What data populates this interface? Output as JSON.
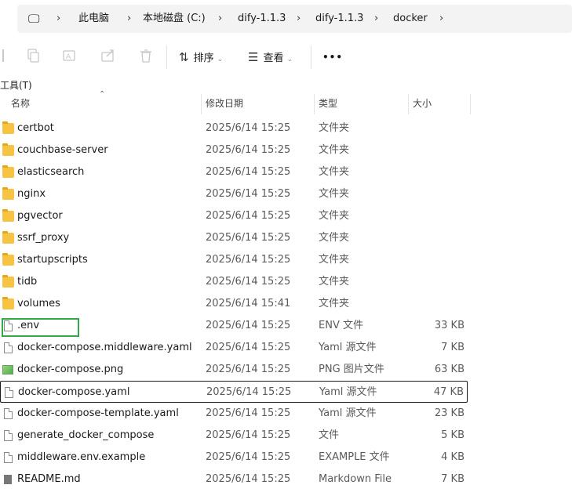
{
  "address": {
    "root_icon": "computer-icon",
    "crumbs": [
      "此电脑",
      "本地磁盘 (C:)",
      "dify-1.1.3",
      "dify-1.1.3",
      "docker"
    ]
  },
  "toolbar": {
    "icons": [
      "cut-icon",
      "copy-icon",
      "rename-icon",
      "share-icon",
      "delete-icon"
    ],
    "sort_label": "排序",
    "view_label": "查看",
    "more_label": "•••"
  },
  "menubar": {
    "tools_label": "工具(T)"
  },
  "columns": {
    "name": "名称",
    "date": "修改日期",
    "type": "类型",
    "size": "大小"
  },
  "files": [
    {
      "name": "certbot",
      "date": "2025/6/14 15:25",
      "type": "文件夹",
      "size": "",
      "icon": "folder-icon"
    },
    {
      "name": "couchbase-server",
      "date": "2025/6/14 15:25",
      "type": "文件夹",
      "size": "",
      "icon": "folder-icon"
    },
    {
      "name": "elasticsearch",
      "date": "2025/6/14 15:25",
      "type": "文件夹",
      "size": "",
      "icon": "folder-icon"
    },
    {
      "name": "nginx",
      "date": "2025/6/14 15:25",
      "type": "文件夹",
      "size": "",
      "icon": "folder-icon"
    },
    {
      "name": "pgvector",
      "date": "2025/6/14 15:25",
      "type": "文件夹",
      "size": "",
      "icon": "folder-icon"
    },
    {
      "name": "ssrf_proxy",
      "date": "2025/6/14 15:25",
      "type": "文件夹",
      "size": "",
      "icon": "folder-icon"
    },
    {
      "name": "startupscripts",
      "date": "2025/6/14 15:25",
      "type": "文件夹",
      "size": "",
      "icon": "folder-icon"
    },
    {
      "name": "tidb",
      "date": "2025/6/14 15:25",
      "type": "文件夹",
      "size": "",
      "icon": "folder-icon"
    },
    {
      "name": "volumes",
      "date": "2025/6/14 15:41",
      "type": "文件夹",
      "size": "",
      "icon": "folder-icon"
    },
    {
      "name": ".env",
      "date": "2025/6/14 15:25",
      "type": "ENV 文件",
      "size": "33 KB",
      "icon": "file-icon"
    },
    {
      "name": "docker-compose.middleware.yaml",
      "date": "2025/6/14 15:25",
      "type": "Yaml 源文件",
      "size": "7 KB",
      "icon": "yaml-file-icon"
    },
    {
      "name": "docker-compose.png",
      "date": "2025/6/14 15:25",
      "type": "PNG 图片文件",
      "size": "63 KB",
      "icon": "image-file-icon"
    },
    {
      "name": "docker-compose.yaml",
      "date": "2025/6/14 15:25",
      "type": "Yaml 源文件",
      "size": "47 KB",
      "icon": "yaml-file-icon"
    },
    {
      "name": "docker-compose-template.yaml",
      "date": "2025/6/14 15:25",
      "type": "Yaml 源文件",
      "size": "23 KB",
      "icon": "yaml-file-icon"
    },
    {
      "name": "generate_docker_compose",
      "date": "2025/6/14 15:25",
      "type": "文件",
      "size": "5 KB",
      "icon": "file-icon"
    },
    {
      "name": "middleware.env.example",
      "date": "2025/6/14 15:25",
      "type": "EXAMPLE 文件",
      "size": "4 KB",
      "icon": "file-icon"
    },
    {
      "name": "README.md",
      "date": "2025/6/14 15:25",
      "type": "Markdown File",
      "size": "7 KB",
      "icon": "markdown-file-icon"
    }
  ],
  "colors": {
    "highlight_box": "#2eaa48",
    "folder": "#f6c342"
  }
}
